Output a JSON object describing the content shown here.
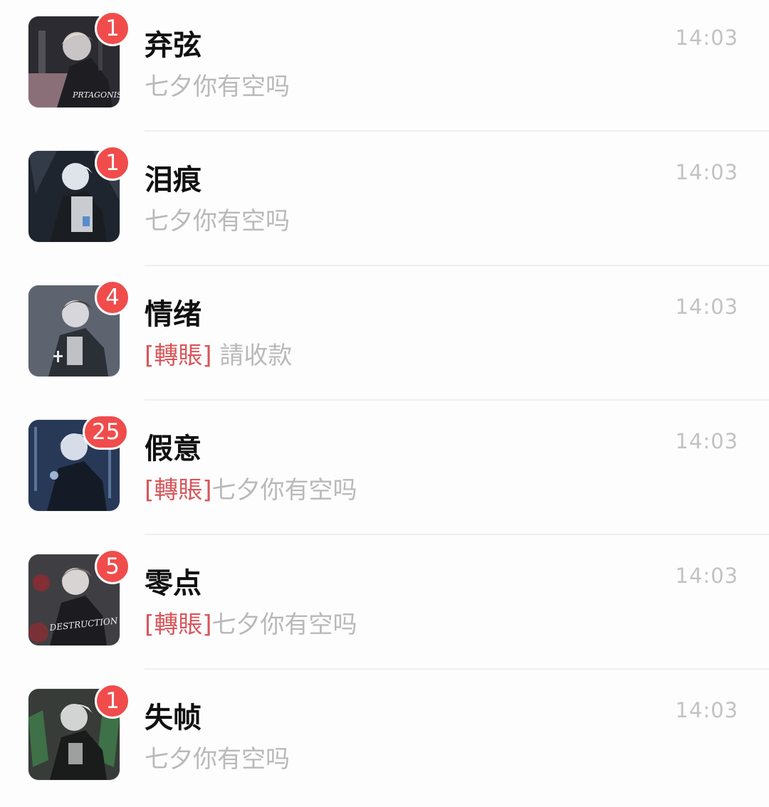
{
  "chats": [
    {
      "name": "弃弦",
      "tag": "",
      "message": "七夕你有空吗",
      "time": "14:03",
      "unread": "1",
      "avatar_colors": [
        "#2b2b31",
        "#c9c4c6",
        "#8d3b48"
      ],
      "avatar_text": "PRTAGONIST"
    },
    {
      "name": "泪痕",
      "tag": "",
      "message": "七夕你有空吗",
      "time": "14:03",
      "unread": "1",
      "avatar_colors": [
        "#1f252e",
        "#dfe3ea",
        "#4d6a8a"
      ],
      "avatar_text": ""
    },
    {
      "name": "情绪",
      "tag": "[轉賬]",
      "message": " 請收款",
      "time": "14:03",
      "unread": "4",
      "avatar_colors": [
        "#3c414b",
        "#d7d7db",
        "#7f8aa0"
      ],
      "avatar_text": ""
    },
    {
      "name": "假意",
      "tag": "[轉賬]",
      "message": "七夕你有空吗",
      "time": "14:03",
      "unread": "25",
      "avatar_colors": [
        "#1b2638",
        "#d6dde8",
        "#4f6f9e"
      ],
      "avatar_text": ""
    },
    {
      "name": "零点",
      "tag": "[轉賬]",
      "message": "七夕你有空吗",
      "time": "14:03",
      "unread": "5",
      "avatar_colors": [
        "#26262a",
        "#d8d4d4",
        "#9a2a2e"
      ],
      "avatar_text": "DESTRUCTION"
    },
    {
      "name": "失帧",
      "tag": "",
      "message": "七夕你有空吗",
      "time": "14:03",
      "unread": "1",
      "avatar_colors": [
        "#202422",
        "#d1d4d2",
        "#3f7a4a"
      ],
      "avatar_text": ""
    }
  ]
}
